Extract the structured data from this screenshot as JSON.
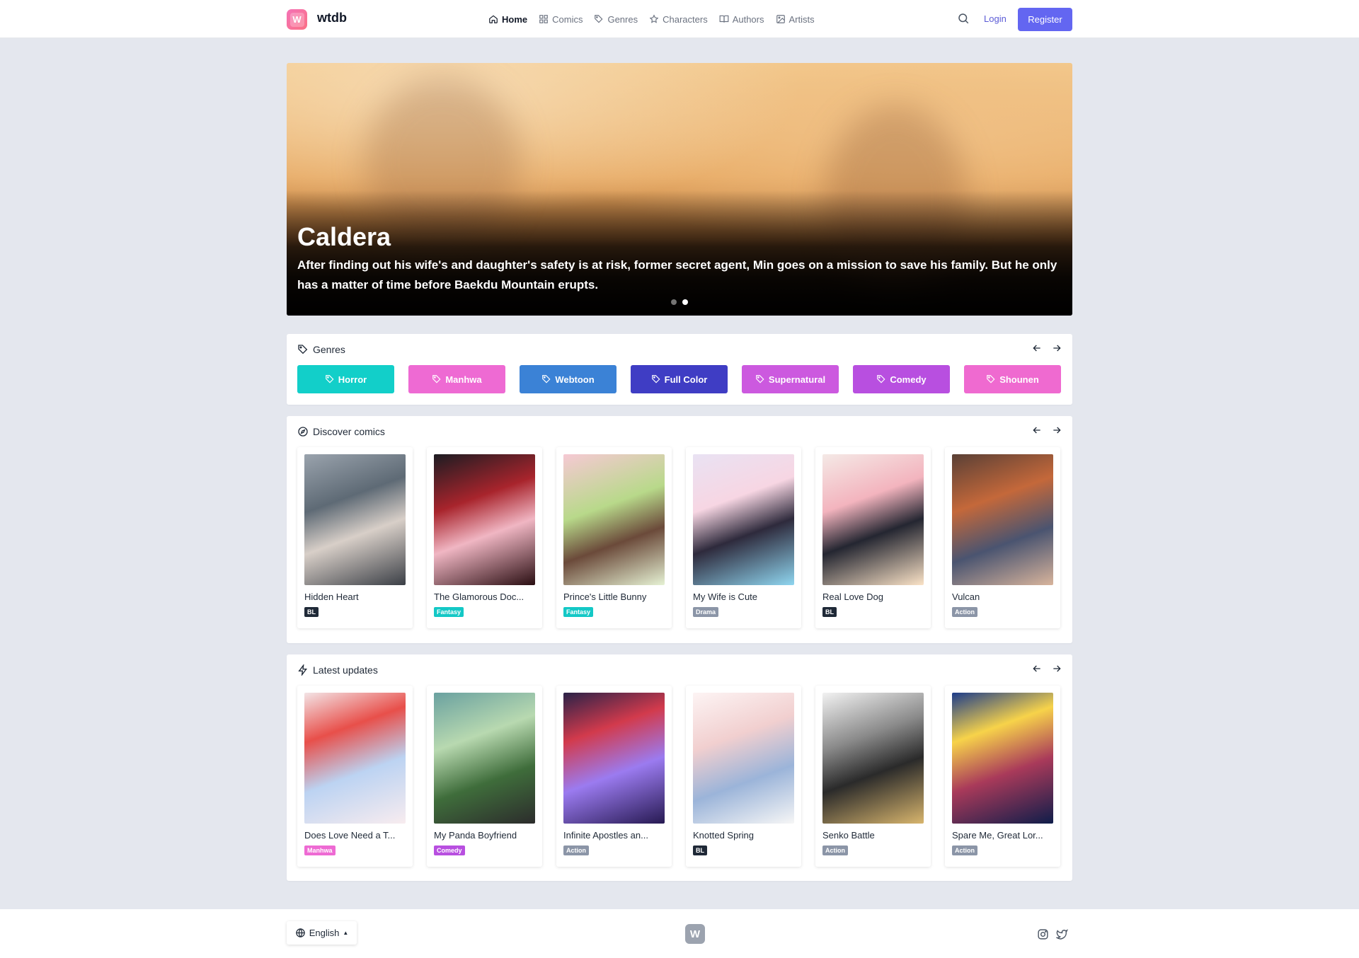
{
  "header": {
    "brand": "wtdb",
    "logo_letter": "W",
    "nav": [
      {
        "label": "Home",
        "icon": "home-icon",
        "active": true
      },
      {
        "label": "Comics",
        "icon": "grid-icon"
      },
      {
        "label": "Genres",
        "icon": "tag-icon"
      },
      {
        "label": "Characters",
        "icon": "star-icon"
      },
      {
        "label": "Authors",
        "icon": "book-icon"
      },
      {
        "label": "Artists",
        "icon": "image-icon"
      }
    ],
    "login_label": "Login",
    "register_label": "Register"
  },
  "hero": {
    "title": "Caldera",
    "description": "After finding out his wife's and daughter's safety is at risk, former secret agent, Min goes on a mission to save his family. But he only has a matter of time before Baekdu Mountain erupts.",
    "slides": 2,
    "active_slide": 2
  },
  "genres_panel": {
    "title": "Genres",
    "items": [
      {
        "label": "Horror",
        "color": "#12cfc9"
      },
      {
        "label": "Manhwa",
        "color": "#ee6ad3"
      },
      {
        "label": "Webtoon",
        "color": "#3b82d6"
      },
      {
        "label": "Full Color",
        "color": "#3f3dc4"
      },
      {
        "label": "Supernatural",
        "color": "#cc59df"
      },
      {
        "label": "Comedy",
        "color": "#b84fe0"
      },
      {
        "label": "Shounen",
        "color": "#ef6ad0"
      }
    ]
  },
  "discover_panel": {
    "title": "Discover comics",
    "items": [
      {
        "title": "Hidden Heart",
        "tag": "BL",
        "tag_color": "#1f2937"
      },
      {
        "title": "The Glamorous Doc...",
        "tag": "Fantasy",
        "tag_color": "#14c8c6"
      },
      {
        "title": "Prince's Little Bunny",
        "tag": "Fantasy",
        "tag_color": "#14c8c6"
      },
      {
        "title": "My Wife is Cute",
        "tag": "Drama",
        "tag_color": "#8b95a7"
      },
      {
        "title": "Real Love Dog",
        "tag": "BL",
        "tag_color": "#1f2937"
      },
      {
        "title": "Vulcan",
        "tag": "Action",
        "tag_color": "#8b95a7"
      }
    ]
  },
  "latest_panel": {
    "title": "Latest updates",
    "items": [
      {
        "title": "Does Love Need a T...",
        "tag": "Manhwa",
        "tag_color": "#ee6ad3"
      },
      {
        "title": "My Panda Boyfriend",
        "tag": "Comedy",
        "tag_color": "#b84fe0"
      },
      {
        "title": "Infinite Apostles an...",
        "tag": "Action",
        "tag_color": "#8b95a7"
      },
      {
        "title": "Knotted Spring",
        "tag": "BL",
        "tag_color": "#1f2937"
      },
      {
        "title": "Senko Battle",
        "tag": "Action",
        "tag_color": "#8b95a7"
      },
      {
        "title": "Spare Me, Great Lor...",
        "tag": "Action",
        "tag_color": "#8b95a7"
      }
    ]
  },
  "footer": {
    "language": "English",
    "logo_letter": "W"
  }
}
